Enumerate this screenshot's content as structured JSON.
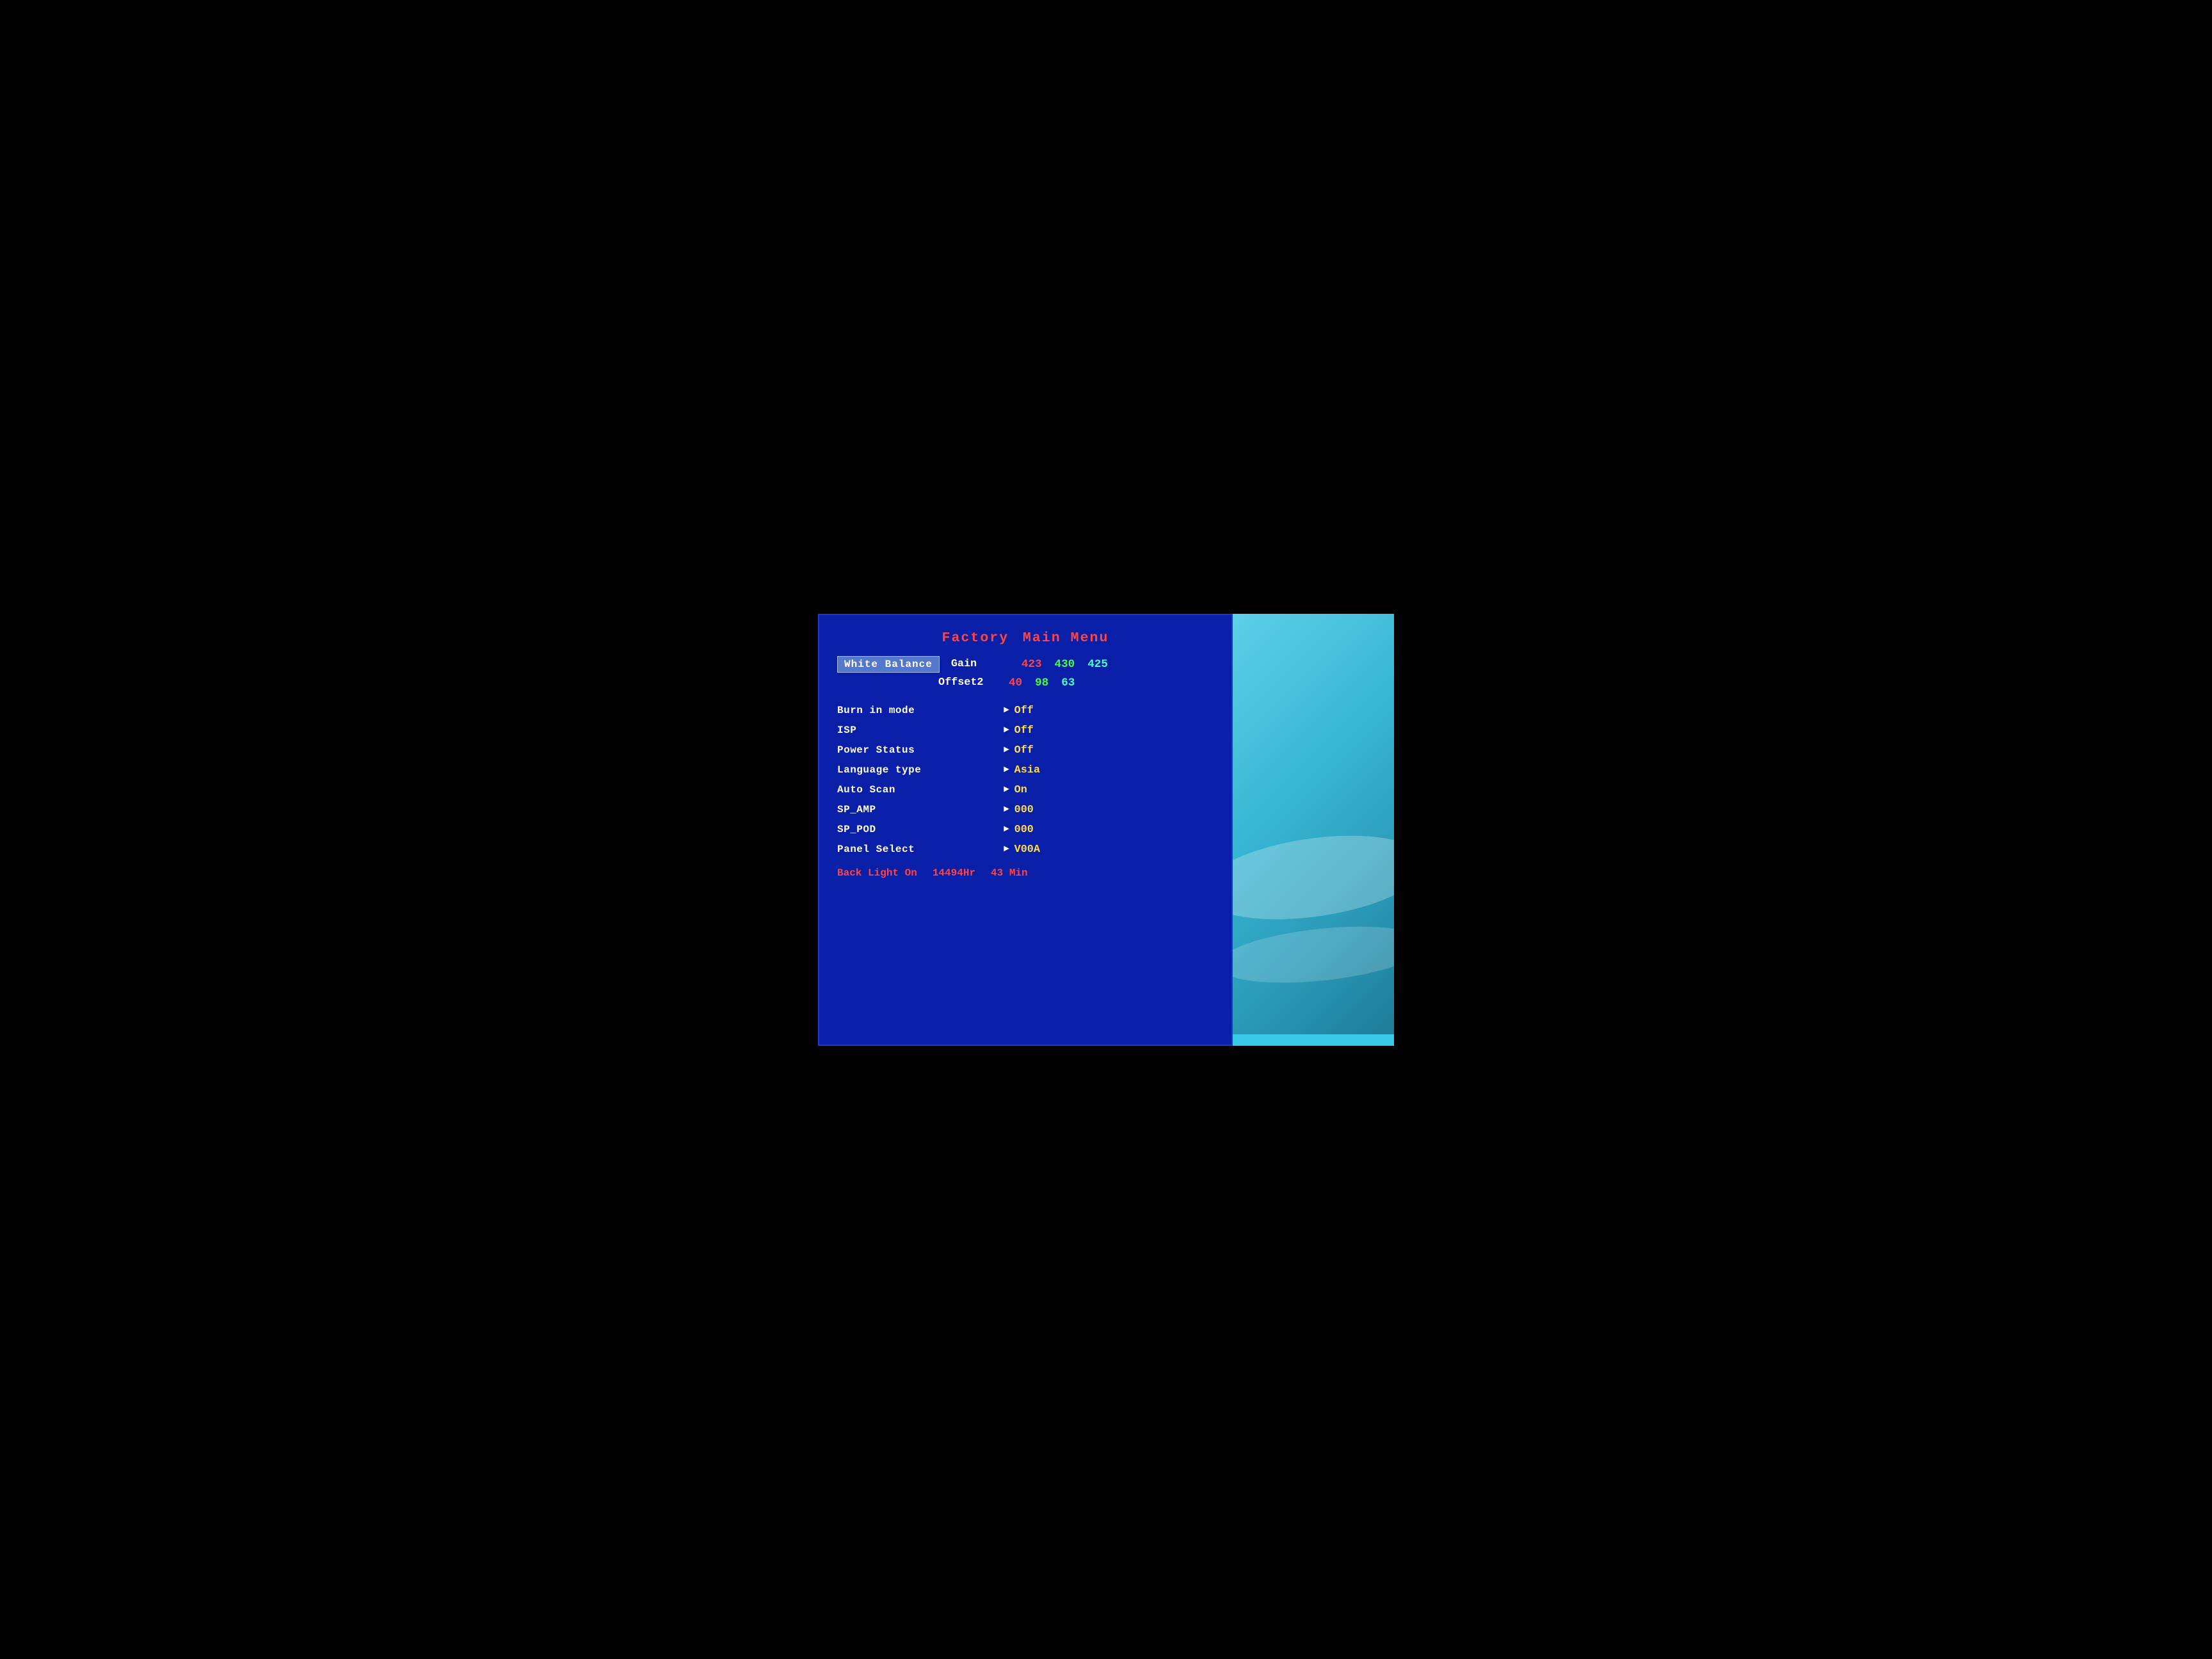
{
  "title": {
    "factory": "Factory",
    "main_menu": "Main Menu"
  },
  "white_balance": {
    "label": "White Balance",
    "gain_label": "Gain",
    "gain_red": "423",
    "gain_green": "430",
    "gain_cyan": "425",
    "offset_label": "Offset2",
    "offset_red": "40",
    "offset_green": "98",
    "offset_cyan": "63"
  },
  "menu_items": [
    {
      "name": "Burn in mode",
      "value": "Off",
      "value_color": "yellow"
    },
    {
      "name": "ISP",
      "value": "Off",
      "value_color": "yellow"
    },
    {
      "name": "Power Status",
      "value": "Off",
      "value_color": "yellow"
    },
    {
      "name": "Language type",
      "value": "Asia",
      "value_color": "yellow"
    },
    {
      "name": "Auto Scan",
      "value": "On",
      "value_color": "yellow"
    },
    {
      "name": "SP_AMP",
      "value": "000",
      "value_color": "yellow"
    },
    {
      "name": "SP_POD",
      "value": "000",
      "value_color": "yellow"
    },
    {
      "name": "Panel Select",
      "value": "V00A",
      "value_color": "yellow"
    }
  ],
  "footer": {
    "label": "Back Light On",
    "hours": "14494Hr",
    "minutes": "43 Min"
  },
  "icons": {
    "arrow_right": "►"
  }
}
